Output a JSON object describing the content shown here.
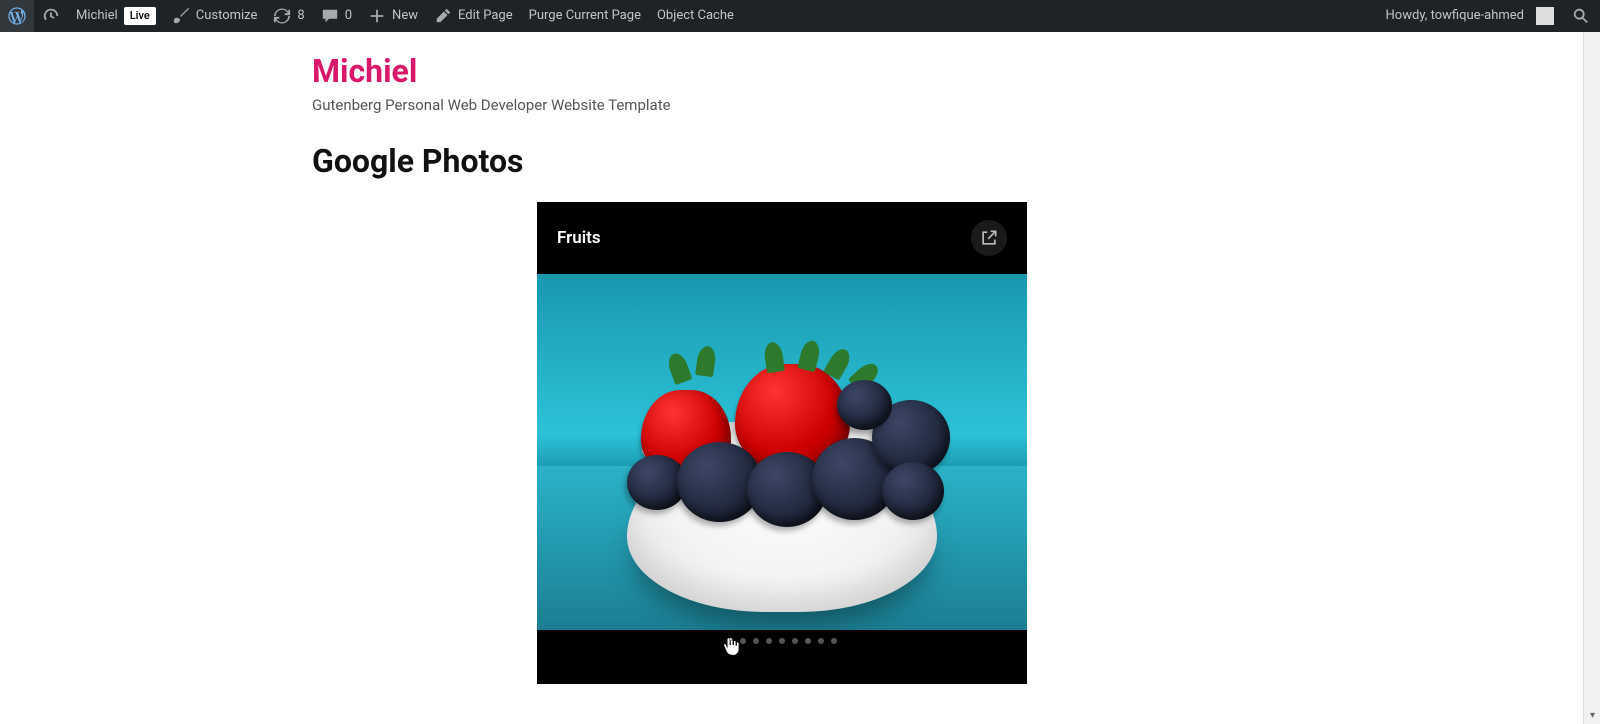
{
  "adminbar": {
    "site_name": "Michiel",
    "live_badge": "Live",
    "customize": "Customize",
    "revisions_count": "8",
    "comments_count": "0",
    "new_label": "New",
    "edit_page": "Edit Page",
    "purge_current": "Purge Current Page",
    "object_cache": "Object Cache",
    "howdy": "Howdy, towfique-ahmed"
  },
  "site": {
    "title": "Michiel",
    "tagline": "Gutenberg Personal Web Developer Website Template"
  },
  "page": {
    "heading": "Google Photos"
  },
  "gphotos": {
    "album_title": "Fruits",
    "open_icon": "open-in-new-icon",
    "dots_total": 9,
    "active_dot_index": 0,
    "colors": {
      "accent": "#d9176b"
    }
  }
}
